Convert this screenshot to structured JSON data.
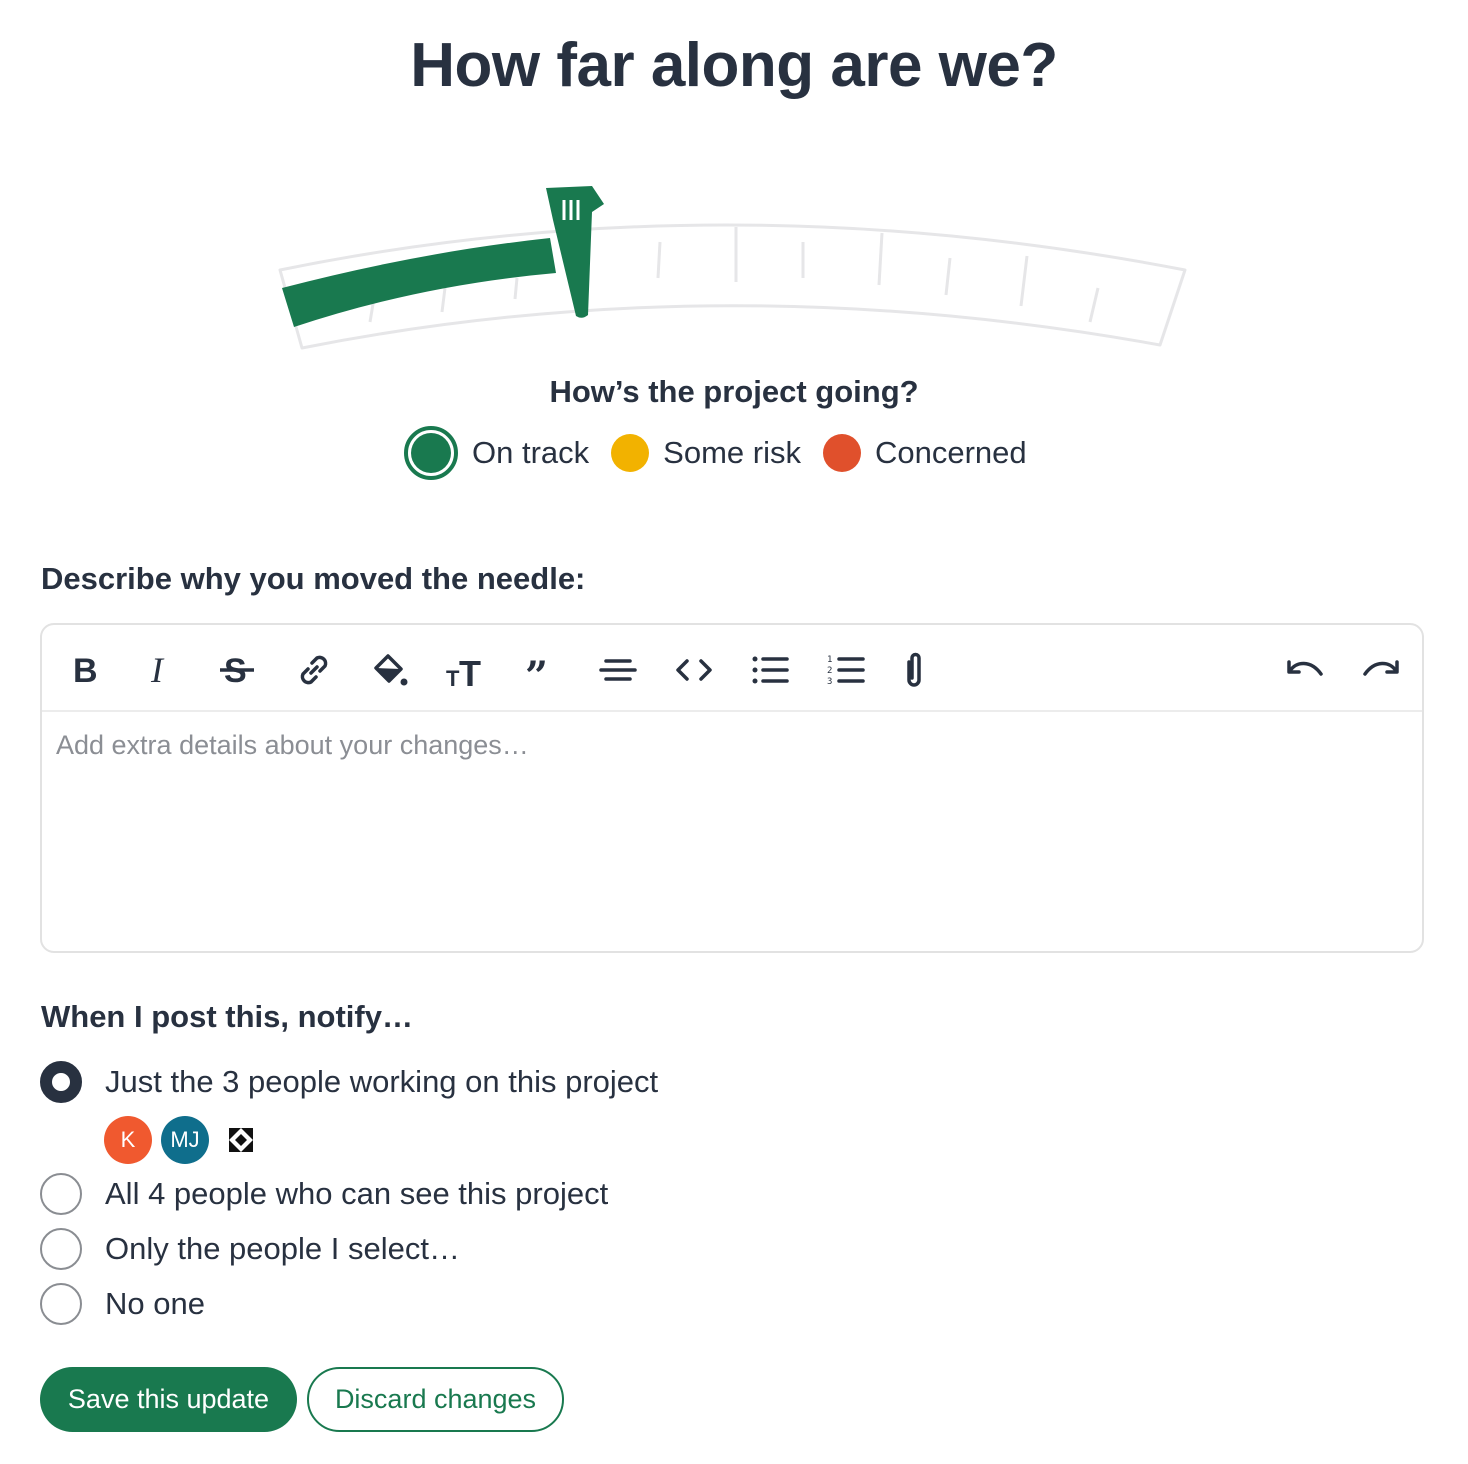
{
  "title": "How far along are we?",
  "progress": {
    "percent": 33,
    "fill_color": "#19794f",
    "track_color": "#e6e6e8"
  },
  "status": {
    "question": "How’s the project going?",
    "options": [
      {
        "label": "On track",
        "color": "#19794f",
        "selected": true
      },
      {
        "label": "Some risk",
        "color": "#f2b200",
        "selected": false
      },
      {
        "label": "Concerned",
        "color": "#e0502c",
        "selected": false
      }
    ]
  },
  "description": {
    "label": "Describe why you moved the needle:",
    "placeholder": "Add extra details about your changes…",
    "toolbar": [
      "bold-icon",
      "italic-icon",
      "strikethrough-icon",
      "link-icon",
      "highlight-icon",
      "text-size-icon",
      "quote-icon",
      "align-center-icon",
      "code-icon",
      "bullet-list-icon",
      "numbered-list-icon",
      "attachment-icon",
      "undo-icon",
      "redo-icon"
    ]
  },
  "notify": {
    "label": "When I post this, notify…",
    "options": [
      {
        "label": "Just the 3 people working on this project",
        "checked": true
      },
      {
        "label": "All 4 people who can see this project",
        "checked": false
      },
      {
        "label": "Only the people I select…",
        "checked": false
      },
      {
        "label": "No one",
        "checked": false
      }
    ],
    "avatars": [
      {
        "initials": "K",
        "color": "#f0592f"
      },
      {
        "initials": "MJ",
        "color": "#0f6e8c"
      }
    ]
  },
  "actions": {
    "save_label": "Save this update",
    "discard_label": "Discard changes"
  }
}
